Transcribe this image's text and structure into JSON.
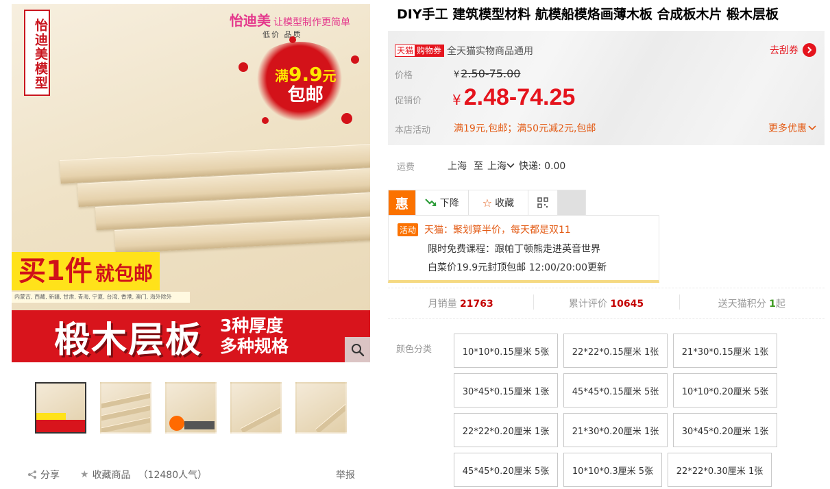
{
  "gallery": {
    "side_title": "怡迪美模型",
    "brand": "怡迪美",
    "brand_slogan": "让模型制作更简单",
    "brand_sub": "低价 品质",
    "promo_line1_prefix": "满",
    "promo_line1_num": "9.9",
    "promo_line1_suffix": "元",
    "promo_line2": "包邮",
    "buy_banner_big": "买1件",
    "buy_banner_small": "就包邮",
    "regions": "内蒙古, 西藏, 新疆, 甘肃, 青海, 宁夏, 台湾, 香港, 澳门, 海外除外",
    "bottom_big": "椴木层板",
    "bottom_spec1": "3种厚度",
    "bottom_spec2": "多种规格",
    "zoom_icon": "search-icon",
    "thumbnails": [
      "thumb-1",
      "thumb-2",
      "thumb-3",
      "thumb-4",
      "thumb-5"
    ]
  },
  "footer": {
    "share": "分享",
    "favorite": "收藏商品",
    "popularity": "（12480人气）",
    "report": "举报"
  },
  "product": {
    "title": "DIY手工 建筑模型材料 航模船模烙画薄木板 合成板木片 椴木层板"
  },
  "price_box": {
    "tag_a": "天猫",
    "tag_b": "购物券",
    "coupon_text": "全天猫实物商品通用",
    "get_coupon": "去刮券",
    "price_label": "价格",
    "currency": "¥",
    "original_price": "2.50-75.00",
    "promo_label": "促销价",
    "promo_price": "2.48-74.25",
    "activity_label": "本店活动",
    "activity_text": "满19元,包邮；满50元减2元,包邮",
    "more_offers": "更多优惠",
    "accent_color": "#e5141d"
  },
  "shipping": {
    "label": "运费",
    "from": "上海",
    "to_word": "至",
    "to": "上海",
    "method": "快递: 0.00"
  },
  "actions": {
    "logo": "惠",
    "price_drop": "下降",
    "favorite": "收藏"
  },
  "events": {
    "badge": "活动",
    "line1": "天猫：聚划算半价，每天都是双11",
    "line2": "限时免费课程：跟帕丁顿熊走进英音世界",
    "line3": "白菜价19.9元封顶包邮 12:00/20:00更新"
  },
  "stats": {
    "monthly_sales_label": "月销量",
    "monthly_sales": "21763",
    "reviews_label": "累计评价",
    "reviews": "10645",
    "points_label": "送天猫积分",
    "points": "1",
    "points_suffix": "起"
  },
  "sku": {
    "label": "颜色分类",
    "options": [
      "10*10*0.15厘米 5张",
      "22*22*0.15厘米 1张",
      "21*30*0.15厘米 1张",
      "30*45*0.15厘米 1张",
      "45*45*0.15厘米 5张",
      "10*10*0.20厘米 5张",
      "22*22*0.20厘米 1张",
      "21*30*0.20厘米 1张",
      "30*45*0.20厘米 1张",
      "45*45*0.20厘米 5张",
      "10*10*0.3厘米 5张",
      "22*22*0.30厘米 1张"
    ]
  }
}
